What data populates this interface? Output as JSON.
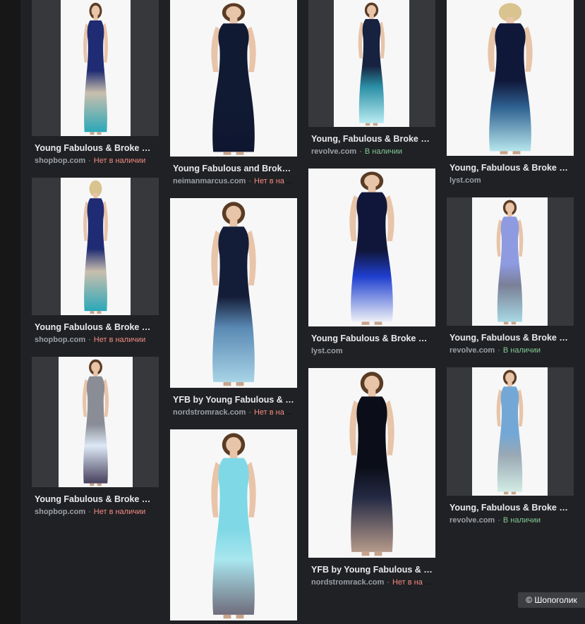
{
  "results": [
    {
      "title": "Young Fabulous & Broke Ha...",
      "domain": "shopbop.com",
      "status": "Нет в наличии",
      "status_type": "out",
      "top": "#1f2b72",
      "mid": "#c9bfae",
      "bottom": "#2aa8b8",
      "back": false
    },
    {
      "title": "Young Fabulous & Broke Ha...",
      "domain": "shopbop.com",
      "status": "Нет в наличии",
      "status_type": "out",
      "top": "#1f2b72",
      "mid": "#c9bfae",
      "bottom": "#2aa8b8",
      "back": true
    },
    {
      "title": "Young Fabulous & Broke Ha...",
      "domain": "shopbop.com",
      "status": "Нет в наличии",
      "status_type": "out",
      "top": "#8a8d96",
      "mid": "#dde9f6",
      "bottom": "#463f5c",
      "back": false
    },
    {
      "title": "Young Fabulous and Broke ...",
      "domain": "neimanmarcus.com",
      "status": "Нет в нал...",
      "status_type": "out",
      "top": "#111a33",
      "mid": "#111a33",
      "bottom": "#0e1530",
      "back": false
    },
    {
      "title": "YFB by Young Fabulous & B...",
      "domain": "nordstromrack.com",
      "status": "Нет в нал...",
      "status_type": "out",
      "top": "#141d38",
      "mid": "#5a89b4",
      "bottom": "#a8d4e6",
      "back": false
    },
    {
      "title": "",
      "domain": "",
      "status": "",
      "status_type": "out",
      "top": "#7fd8e6",
      "mid": "#a9e6ee",
      "bottom": "#6f6c7c",
      "back": false
    },
    {
      "title": "Young, Fabulous & Broke Ha...",
      "domain": "revolve.com",
      "status": "В наличии",
      "status_type": "in",
      "top": "#16223f",
      "mid": "#2b8fa6",
      "bottom": "#b9ecf2",
      "back": false
    },
    {
      "title": "Young Fabulous & Broke Ma...",
      "domain": "lyst.com",
      "status": "",
      "status_type": "out",
      "top": "#10163a",
      "mid": "#1f3fcf",
      "bottom": "#eef1f8",
      "back": false
    },
    {
      "title": "YFB by Young Fabulous & B...",
      "domain": "nordstromrack.com",
      "status": "Нет в нал...",
      "status_type": "out",
      "top": "#0b0d18",
      "mid": "#242a44",
      "bottom": "#b59a8a",
      "back": false
    },
    {
      "title": "Young, Fabulous & Broke Ha...",
      "domain": "lyst.com",
      "status": "",
      "status_type": "out",
      "top": "#10183a",
      "mid": "#2d5f8f",
      "bottom": "#b6e6ec",
      "back": true
    },
    {
      "title": "Young, Fabulous & Broke H...",
      "domain": "revolve.com",
      "status": "В наличии",
      "status_type": "in",
      "top": "#8e9be0",
      "mid": "#7a7f96",
      "bottom": "#a7d9e3",
      "back": false
    },
    {
      "title": "Young, Fabulous & Broke H...",
      "domain": "revolve.com",
      "status": "В наличии",
      "status_type": "in",
      "top": "#73a8d6",
      "mid": "#9aa8b4",
      "bottom": "#d2ece4",
      "back": false
    }
  ],
  "separator": "·",
  "watermark": "© Шопоголик",
  "colors": {
    "background": "#202124",
    "title": "#e8eaed",
    "domain": "#9aa0a6",
    "out_of_stock": "#f28b82",
    "in_stock": "#81c995"
  }
}
